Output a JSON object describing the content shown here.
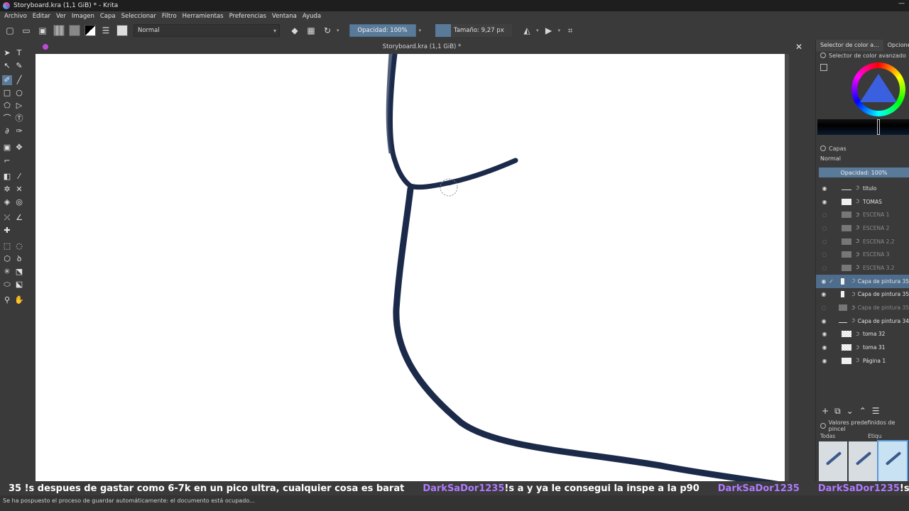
{
  "window": {
    "title": "Storyboard.kra (1,1 GiB) * - Krita",
    "minimize_glyph": "—"
  },
  "menu": [
    "Archivo",
    "Editar",
    "Ver",
    "Imagen",
    "Capa",
    "Seleccionar",
    "Filtro",
    "Herramientas",
    "Preferencias",
    "Ventana",
    "Ayuda"
  ],
  "toolbar": {
    "blend_mode": "Normal",
    "opacity_label": "Opacidad: 100%",
    "size_label": "Tamaño: 9,27 px"
  },
  "document": {
    "tab_title": "Storyboard.kra (1,1 GiB) *",
    "close_glyph": "✕"
  },
  "colors": {
    "accent": "#5a7a9a",
    "stroke": "#1c2a4a"
  },
  "dock": {
    "tab_color_selector": "Selector de color a...",
    "tab_options": "Opcione",
    "advanced_color_header": "Selector de color avanzado",
    "layers_title": "Capas",
    "layers_blend": "Normal",
    "layers_opacity": "Opacidad:  100%",
    "layers": [
      {
        "name": "titulo",
        "visible": true,
        "dim": false,
        "thumb": "line",
        "selected": false,
        "check": ""
      },
      {
        "name": "TOMAS",
        "visible": true,
        "dim": false,
        "thumb": "white",
        "selected": false,
        "check": ""
      },
      {
        "name": "ESCENA 1",
        "visible": false,
        "dim": true,
        "thumb": "gray",
        "selected": false,
        "check": ""
      },
      {
        "name": "ESCENA 2",
        "visible": false,
        "dim": true,
        "thumb": "gray",
        "selected": false,
        "check": ""
      },
      {
        "name": "ESCENA 2.2",
        "visible": false,
        "dim": true,
        "thumb": "gray",
        "selected": false,
        "check": ""
      },
      {
        "name": "ESCENA 3",
        "visible": false,
        "dim": true,
        "thumb": "gray",
        "selected": false,
        "check": ""
      },
      {
        "name": "ESCENA 3.2",
        "visible": false,
        "dim": true,
        "thumb": "gray",
        "selected": false,
        "check": ""
      },
      {
        "name": "Capa de pintura 35",
        "visible": true,
        "dim": false,
        "thumb": "narrow",
        "selected": true,
        "check": "✓"
      },
      {
        "name": "Capa de pintura 35",
        "visible": true,
        "dim": false,
        "thumb": "narrow",
        "selected": false,
        "check": ""
      },
      {
        "name": "Capa de pintura 35",
        "visible": false,
        "dim": true,
        "thumb": "gray",
        "selected": false,
        "check": ""
      },
      {
        "name": "Capa de pintura 34",
        "visible": true,
        "dim": false,
        "thumb": "line",
        "selected": false,
        "check": ""
      },
      {
        "name": "toma 32",
        "visible": true,
        "dim": false,
        "thumb": "checker",
        "selected": false,
        "check": ""
      },
      {
        "name": "toma 31",
        "visible": true,
        "dim": false,
        "thumb": "checker",
        "selected": false,
        "check": ""
      },
      {
        "name": "Página 1",
        "visible": true,
        "dim": false,
        "thumb": "white",
        "selected": false,
        "check": ""
      }
    ],
    "presets_header": "Valores predefinidos de pincel",
    "presets_filter": "Todas",
    "presets_tag": "Etiqu"
  },
  "chat": [
    {
      "name": "",
      "text": "35 !s despues de gastar como 6-7k en un pico ultra, cualquier cosa es barat"
    },
    {
      "name": "DarkSaDor1235",
      "text": " !s a y ya le consegui la inspe a la p90"
    },
    {
      "name": "DarkSaDor1235",
      "text": ""
    },
    {
      "name": "DarkSaDor1235",
      "text": " !s empireo"
    }
  ],
  "status": {
    "message": "Se ha pospuesto el proceso de guardar automáticamente: el documento está ocupado..."
  }
}
